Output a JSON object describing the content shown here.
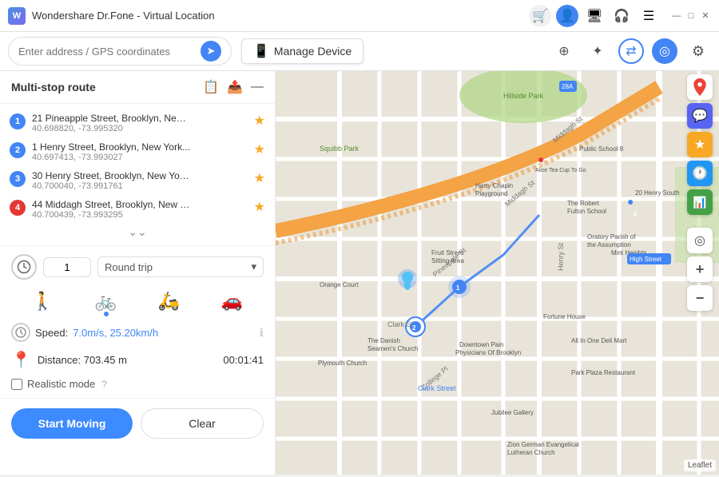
{
  "titlebar": {
    "logo_text": "W",
    "title": "Wondershare Dr.Fone - Virtual Location",
    "icons": [
      "🛒",
      "👤",
      "🖥",
      "🎧",
      "☰"
    ],
    "controls": [
      "—",
      "□",
      "✕"
    ]
  },
  "toolbar": {
    "search_placeholder": "Enter address / GPS coordinates",
    "manage_device_label": "Manage Device",
    "toolbar_icons": [
      {
        "name": "crosshair-icon",
        "symbol": "⊕",
        "active": false
      },
      {
        "name": "route-icon",
        "symbol": "✦",
        "active": false
      },
      {
        "name": "multi-stop-icon",
        "symbol": "⇄",
        "active": false
      },
      {
        "name": "virtual-icon",
        "symbol": "◎",
        "active": true
      },
      {
        "name": "settings-icon",
        "symbol": "⚙",
        "active": false
      }
    ]
  },
  "sidebar": {
    "title": "Multi-stop route",
    "routes": [
      {
        "num": "1",
        "color": "blue",
        "address": "21 Pineapple Street, Brooklyn, New York ...",
        "coords": "40.698820, -73.995320",
        "starred": true
      },
      {
        "num": "2",
        "color": "blue",
        "address": "1 Henry Street, Brooklyn, New York...",
        "coords": "40.697413, -73.993027",
        "starred": true
      },
      {
        "num": "3",
        "color": "blue",
        "address": "30 Henry Street, Brooklyn, New York ...",
        "coords": "40.700040, -73.991761",
        "starred": true
      },
      {
        "num": "4",
        "color": "red",
        "address": "44 Middagh Street, Brooklyn, New Y...",
        "coords": "40.700439, -73.993295",
        "starred": true
      }
    ],
    "speed_value": "1",
    "trip_type": "Round trip",
    "transport_modes": [
      "🚶",
      "🚲",
      "🛵",
      "🚗"
    ],
    "speed_label": "Speed:",
    "speed_display": "7.0m/s, 25.20km/h",
    "distance_label": "Distance: 703.45 m",
    "time_display": "00:01:41",
    "realistic_mode_label": "Realistic mode",
    "start_btn": "Start Moving",
    "clear_btn": "Clear"
  },
  "map": {
    "attribution": "Leaflet"
  }
}
